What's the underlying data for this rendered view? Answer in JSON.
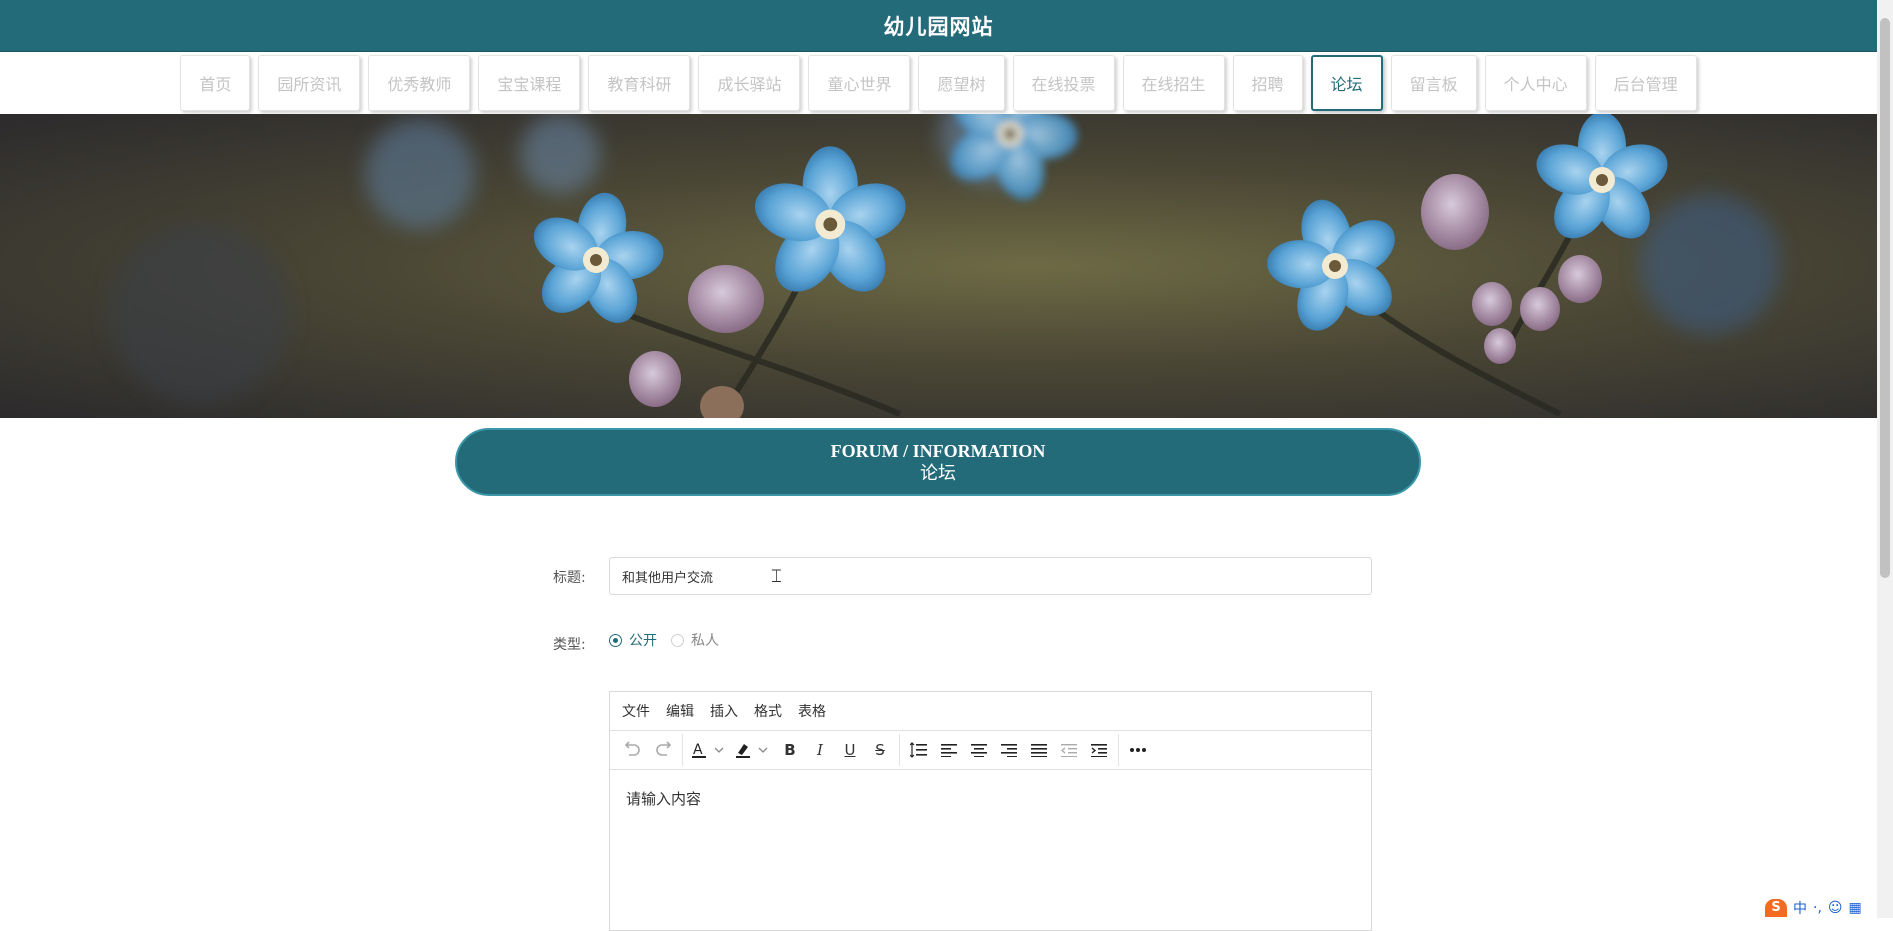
{
  "site": {
    "title": "幼儿园网站"
  },
  "nav": {
    "items": [
      {
        "label": "首页"
      },
      {
        "label": "园所资讯"
      },
      {
        "label": "优秀教师"
      },
      {
        "label": "宝宝课程"
      },
      {
        "label": "教育科研"
      },
      {
        "label": "成长驿站"
      },
      {
        "label": "童心世界"
      },
      {
        "label": "愿望树"
      },
      {
        "label": "在线投票"
      },
      {
        "label": "在线招生"
      },
      {
        "label": "招聘"
      },
      {
        "label": "论坛"
      },
      {
        "label": "留言板"
      },
      {
        "label": "个人中心"
      },
      {
        "label": "后台管理"
      }
    ],
    "active_label": "论坛"
  },
  "section": {
    "title_en": "FORUM / INFORMATION",
    "title_cn": "论坛"
  },
  "form": {
    "title_label": "标题:",
    "title_value": "和其他用户交流",
    "type_label": "类型:",
    "type_options": [
      {
        "label": "公开",
        "checked": true
      },
      {
        "label": "私人",
        "checked": false
      }
    ]
  },
  "editor": {
    "menus": [
      "文件",
      "编辑",
      "插入",
      "格式",
      "表格"
    ],
    "toolbar_icons": [
      "undo-icon",
      "redo-icon",
      "text-color-icon",
      "highlight-color-icon",
      "bold-icon",
      "italic-icon",
      "underline-icon",
      "strikethrough-icon",
      "line-height-icon",
      "align-left-icon",
      "align-center-icon",
      "align-right-icon",
      "align-justify-icon",
      "outdent-icon",
      "indent-icon",
      "more-icon"
    ],
    "body_text": "请输入内容"
  },
  "ime": {
    "label": "中"
  },
  "colors": {
    "brand": "#236b79",
    "brand_light": "#3a97a9",
    "nav_text": "#c4c4c4",
    "ime_orange": "#f36b21"
  }
}
